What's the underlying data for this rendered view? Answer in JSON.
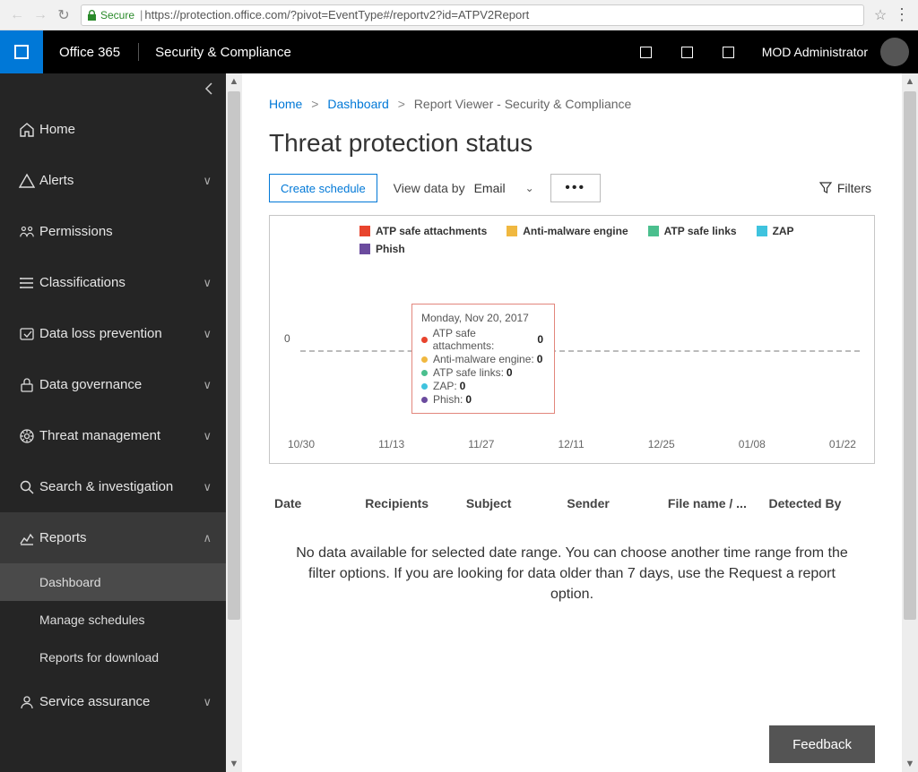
{
  "browser": {
    "secure_label": "Secure",
    "url": "https://protection.office.com/?pivot=EventType#/reportv2?id=ATPV2Report"
  },
  "header": {
    "brand": "Office 365",
    "app": "Security & Compliance",
    "user": "MOD Administrator"
  },
  "sidebar": {
    "items": [
      {
        "label": "Home",
        "icon": "home"
      },
      {
        "label": "Alerts",
        "icon": "alert",
        "expandable": true
      },
      {
        "label": "Permissions",
        "icon": "permissions"
      },
      {
        "label": "Classifications",
        "icon": "class",
        "expandable": true
      },
      {
        "label": "Data loss prevention",
        "icon": "dlp",
        "expandable": true
      },
      {
        "label": "Data governance",
        "icon": "lock",
        "expandable": true
      },
      {
        "label": "Threat management",
        "icon": "threat",
        "expandable": true
      },
      {
        "label": "Search & investigation",
        "icon": "search",
        "expandable": true
      },
      {
        "label": "Reports",
        "icon": "reports",
        "expandable": true,
        "expanded": true,
        "selected": true,
        "children": [
          {
            "label": "Dashboard",
            "selected": true
          },
          {
            "label": "Manage schedules"
          },
          {
            "label": "Reports for download"
          }
        ]
      },
      {
        "label": "Service assurance",
        "icon": "assurance",
        "expandable": true
      }
    ]
  },
  "breadcrumb": {
    "home": "Home",
    "dashboard": "Dashboard",
    "current": "Report Viewer - Security & Compliance"
  },
  "page": {
    "title": "Threat protection status",
    "create_schedule": "Create schedule",
    "view_data_by": "View data by",
    "view_select": "Email",
    "filters": "Filters",
    "feedback": "Feedback",
    "nodata": "No data available for selected date range. You can choose another time range from the filter options. If you are looking for data older than 7 days, use the Request a report option."
  },
  "table": {
    "columns": [
      "Date",
      "Recipients",
      "Subject",
      "Sender",
      "File name / ...",
      "Detected By"
    ]
  },
  "chart_data": {
    "type": "line",
    "title": "",
    "xlabel": "",
    "ylabel": "",
    "ylim": [
      0,
      0
    ],
    "x": [
      "10/30",
      "11/13",
      "11/27",
      "12/11",
      "12/25",
      "01/08",
      "01/22"
    ],
    "series": [
      {
        "name": "ATP safe attachments",
        "color": "#e8442d",
        "values": [
          0,
          0,
          0,
          0,
          0,
          0,
          0
        ]
      },
      {
        "name": "Anti-malware engine",
        "color": "#f0b840",
        "values": [
          0,
          0,
          0,
          0,
          0,
          0,
          0
        ]
      },
      {
        "name": "ATP safe links",
        "color": "#4bbf8e",
        "values": [
          0,
          0,
          0,
          0,
          0,
          0,
          0
        ]
      },
      {
        "name": "ZAP",
        "color": "#3fc3de",
        "values": [
          0,
          0,
          0,
          0,
          0,
          0,
          0
        ]
      },
      {
        "name": "Phish",
        "color": "#6b4b9e",
        "values": [
          0,
          0,
          0,
          0,
          0,
          0,
          0
        ]
      }
    ],
    "tooltip": {
      "date": "Monday, Nov 20, 2017",
      "rows": [
        {
          "label": "ATP safe attachments",
          "value": "0",
          "color": "#e8442d"
        },
        {
          "label": "Anti-malware engine",
          "value": "0",
          "color": "#f0b840"
        },
        {
          "label": "ATP safe links",
          "value": "0",
          "color": "#4bbf8e"
        },
        {
          "label": "ZAP",
          "value": "0",
          "color": "#3fc3de"
        },
        {
          "label": "Phish",
          "value": "0",
          "color": "#6b4b9e"
        }
      ]
    }
  }
}
